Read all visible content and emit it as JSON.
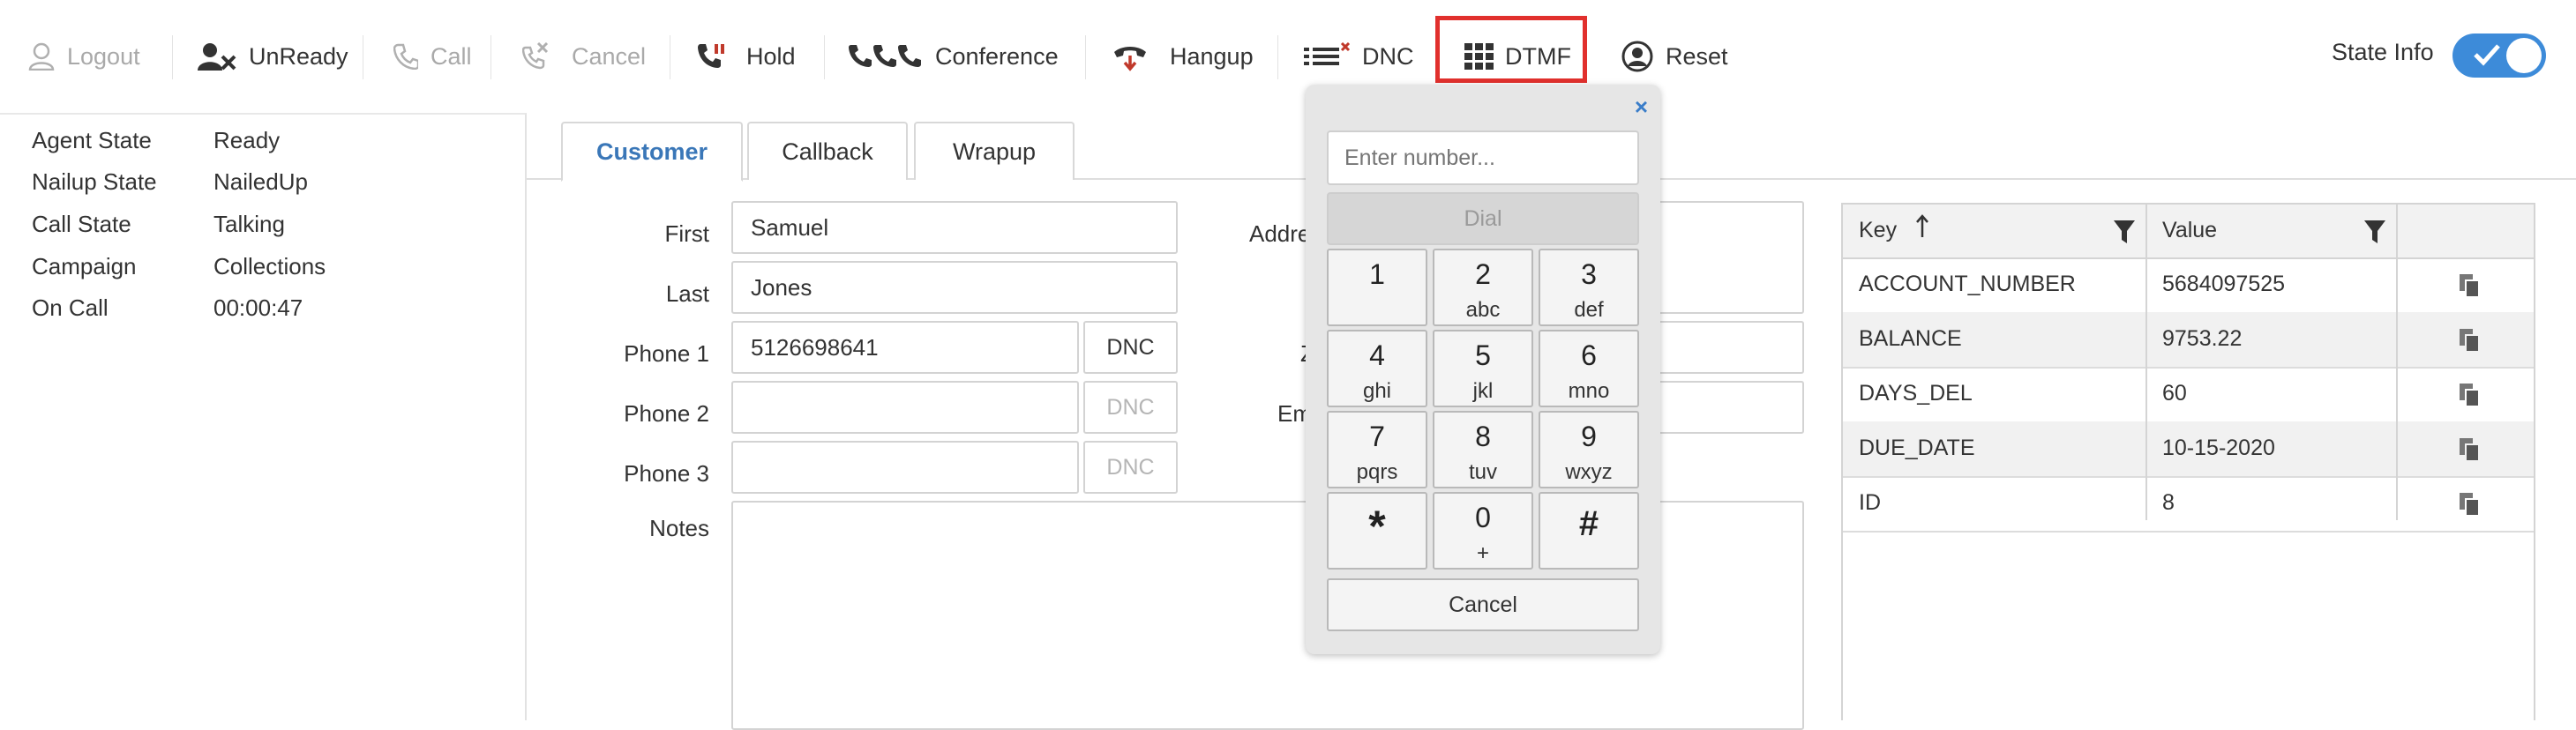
{
  "toolbar": {
    "logout": "Logout",
    "unready": "UnReady",
    "call": "Call",
    "cancel": "Cancel",
    "hold": "Hold",
    "conference": "Conference",
    "hangup": "Hangup",
    "dnc": "DNC",
    "dtmf": "DTMF",
    "reset": "Reset",
    "state_info": "State Info",
    "state_info_on": true,
    "highlight_color": "#e1302d",
    "accent_color": "#3d8bd9"
  },
  "state": {
    "rows": [
      {
        "key": "Agent State",
        "value": "Ready"
      },
      {
        "key": "Nailup State",
        "value": "NailedUp"
      },
      {
        "key": "Call State",
        "value": "Talking"
      },
      {
        "key": "Campaign",
        "value": "Collections"
      },
      {
        "key": "On Call",
        "value": "00:00:47"
      }
    ]
  },
  "tabs": [
    {
      "label": "Customer",
      "active": true
    },
    {
      "label": "Callback",
      "active": false
    },
    {
      "label": "Wrapup",
      "active": false
    }
  ],
  "form": {
    "first_label": "First",
    "first_value": "Samuel",
    "last_label": "Last",
    "last_value": "Jones",
    "phone1_label": "Phone 1",
    "phone1_value": "5126698641",
    "phone2_label": "Phone 2",
    "phone2_value": "",
    "phone3_label": "Phone 3",
    "phone3_value": "",
    "dnc_label": "DNC",
    "notes_label": "Notes",
    "address_label": "Addre",
    "zip_label": "Z",
    "email_label": "Em"
  },
  "kv": {
    "key_header": "Key",
    "value_header": "Value",
    "rows": [
      {
        "key": "ACCOUNT_NUMBER",
        "value": "5684097525"
      },
      {
        "key": "BALANCE",
        "value": "9753.22"
      },
      {
        "key": "DAYS_DEL",
        "value": "60"
      },
      {
        "key": "DUE_DATE",
        "value": "10-15-2020"
      },
      {
        "key": "ID",
        "value": "8"
      }
    ]
  },
  "dtmf": {
    "close": "×",
    "placeholder": "Enter number...",
    "dial": "Dial",
    "keys": [
      {
        "d": "1",
        "l": ""
      },
      {
        "d": "2",
        "l": "abc"
      },
      {
        "d": "3",
        "l": "def"
      },
      {
        "d": "4",
        "l": "ghi"
      },
      {
        "d": "5",
        "l": "jkl"
      },
      {
        "d": "6",
        "l": "mno"
      },
      {
        "d": "7",
        "l": "pqrs"
      },
      {
        "d": "8",
        "l": "tuv"
      },
      {
        "d": "9",
        "l": "wxyz"
      },
      {
        "d": "*",
        "l": ""
      },
      {
        "d": "0",
        "l": "+"
      },
      {
        "d": "#",
        "l": ""
      }
    ],
    "cancel": "Cancel"
  }
}
